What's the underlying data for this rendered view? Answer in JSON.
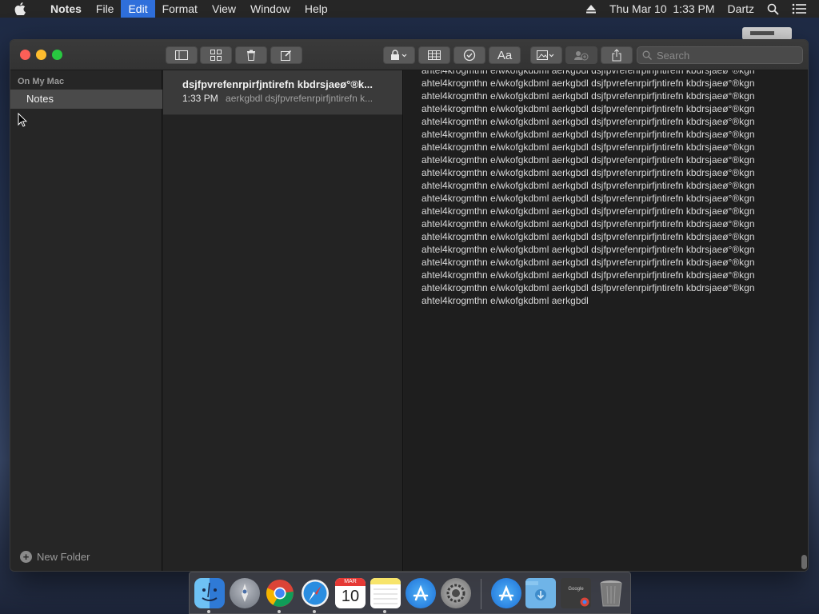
{
  "menubar": {
    "app_name": "Notes",
    "items": [
      "File",
      "Edit",
      "Format",
      "View",
      "Window",
      "Help"
    ],
    "active_item": "Edit",
    "clock": "Thu Mar 10  1:33 PM",
    "user": "Dartz",
    "icons": [
      "apple-icon",
      "eject-icon",
      "spotlight-icon",
      "notification-center-icon"
    ]
  },
  "toolbar": {
    "search_placeholder": "Search",
    "buttons": [
      "sidebar-toggle",
      "attachments-browser",
      "delete",
      "new-note",
      "lock",
      "table",
      "checklist",
      "text-format",
      "media",
      "collaborate",
      "share"
    ]
  },
  "sidebar": {
    "section_title": "On My Mac",
    "folders": [
      {
        "label": "Notes",
        "selected": true
      }
    ],
    "new_folder_label": "New Folder"
  },
  "notes_list": {
    "items": [
      {
        "title": "dsjfpvrefenrpirfjntirefn kbdrsjaeø°®k...",
        "time": "1:33 PM",
        "preview": "aerkgbdl dsjfpvrefenrpirfjntirefn k..."
      }
    ]
  },
  "editor": {
    "body_text": "ahtel4krogmthn e/wkofgkdbml aerkgbdl dsjfpvrefenrpirfjntirefn kbdrsjaeø°®kgn ahtel4krogmthn e/wkofgkdbml aerkgbdl dsjfpvrefenrpirfjntirefn kbdrsjaeø°®kgn ahtel4krogmthn e/wkofgkdbml aerkgbdl dsjfpvrefenrpirfjntirefn kbdrsjaeø°®kgn ahtel4krogmthn e/wkofgkdbml aerkgbdl dsjfpvrefenrpirfjntirefn kbdrsjaeø°®kgn ahtel4krogmthn e/wkofgkdbml aerkgbdl dsjfpvrefenrpirfjntirefn kbdrsjaeø°®kgn ahtel4krogmthn e/wkofgkdbml aerkgbdl dsjfpvrefenrpirfjntirefn kbdrsjaeø°®kgn ahtel4krogmthn e/wkofgkdbml aerkgbdl dsjfpvrefenrpirfjntirefn kbdrsjaeø°®kgn ahtel4krogmthn e/wkofgkdbml aerkgbdl dsjfpvrefenrpirfjntirefn kbdrsjaeø°®kgn ahtel4krogmthn e/wkofgkdbml aerkgbdl dsjfpvrefenrpirfjntirefn kbdrsjaeø°®kgn ahtel4krogmthn e/wkofgkdbml aerkgbdl dsjfpvrefenrpirfjntirefn kbdrsjaeø°®kgn ahtel4krogmthn e/wkofgkdbml aerkgbdl dsjfpvrefenrpirfjntirefn kbdrsjaeø°®kgn ahtel4krogmthn e/wkofgkdbml aerkgbdl dsjfpvrefenrpirfjntirefn kbdrsjaeø°®kgn ahtel4krogmthn e/wkofgkdbml aerkgbdl dsjfpvrefenrpirfjntirefn kbdrsjaeø°®kgn ahtel4krogmthn e/wkofgkdbml aerkgbdl dsjfpvrefenrpirfjntirefn kbdrsjaeø°®kgn ahtel4krogmthn e/wkofgkdbml aerkgbdl dsjfpvrefenrpirfjntirefn kbdrsjaeø°®kgn ahtel4krogmthn e/wkofgkdbml aerkgbdl dsjfpvrefenrpirfjntirefn kbdrsjaeø°®kgn ahtel4krogmthn e/wkofgkdbml aerkgbdl dsjfpvrefenrpirfjntirefn kbdrsjaeø°®kgn ahtel4krogmthn e/wkofgkdbml aerkgbdl dsjfpvrefenrpirfjntirefn kbdrsjaeø°®kgn ahtel4krogmthn e/wkofgkdbml aerkgbdl"
  },
  "dock": {
    "apps": [
      {
        "name": "finder-icon",
        "running": true,
        "color": "#3a8ee6"
      },
      {
        "name": "launchpad-icon",
        "running": false,
        "color": "#8a8f99"
      },
      {
        "name": "chrome-icon",
        "running": true,
        "color": "#e0e0e0"
      },
      {
        "name": "safari-icon",
        "running": true,
        "color": "#2a8de0"
      },
      {
        "name": "calendar-icon",
        "running": false,
        "color": "#ffffff",
        "month": "MAR",
        "day": "10"
      },
      {
        "name": "notes-icon",
        "running": true,
        "color": "#f7e46a"
      },
      {
        "name": "app-store-icon",
        "running": false,
        "color": "#2a8ae6"
      },
      {
        "name": "system-preferences-icon",
        "running": false,
        "color": "#9a9a9a"
      },
      {
        "name": "applications-folder-icon",
        "running": false,
        "color": "#2a8ae6"
      },
      {
        "name": "downloads-folder-icon",
        "running": false,
        "color": "#6fb4e8"
      },
      {
        "name": "recent-chrome-stack-icon",
        "running": false,
        "color": "#444444",
        "label": "Google"
      },
      {
        "name": "trash-icon",
        "running": false,
        "color": "#8a8a8a"
      }
    ]
  },
  "colors": {
    "accent": "#2f6fdb",
    "window_bg": "#1f1f1f",
    "selection": "#4a4a4a"
  }
}
